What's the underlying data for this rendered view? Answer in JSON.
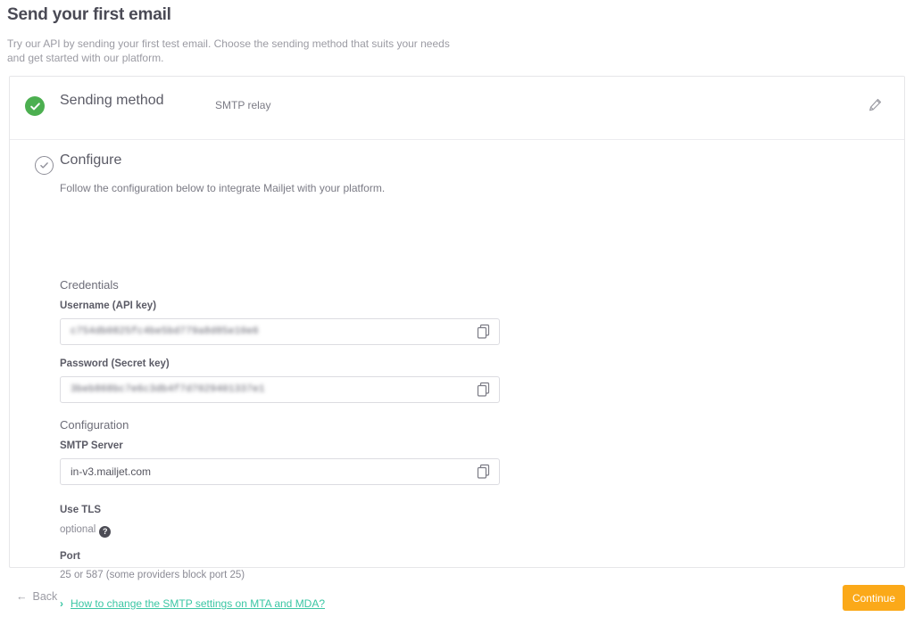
{
  "header": {
    "title": "Send your first email",
    "subtitle": "Try our API by sending your first test email. Choose the sending method that suits your needs and get started with our platform."
  },
  "steps": {
    "sending_method": {
      "label": "Sending method",
      "value": "SMTP relay",
      "edit_icon": "pencil-icon",
      "status_icon": "check-circle-filled-icon"
    },
    "configure": {
      "label": "Configure",
      "description": "Follow the configuration below to integrate Mailjet with your platform.",
      "status_icon": "check-circle-outline-icon"
    }
  },
  "credentials": {
    "section_title": "Credentials",
    "username": {
      "label": "Username (API key)",
      "value": "c754db0825fc4be5bd779a8d85e10e6",
      "redacted": true,
      "copy_icon": "copy-icon"
    },
    "password": {
      "label": "Password (Secret key)",
      "value": "3beb868bc7e6c3db4f7d7029401337e1",
      "redacted": true,
      "copy_icon": "copy-icon"
    }
  },
  "configuration": {
    "section_title": "Configuration",
    "smtp_server": {
      "label": "SMTP Server",
      "value": "in-v3.mailjet.com",
      "copy_icon": "copy-icon"
    },
    "use_tls": {
      "label": "Use TLS",
      "value": "optional",
      "help_icon": "question-mark-icon"
    },
    "port": {
      "label": "Port",
      "value": "25 or 587 (some providers block port 25)"
    }
  },
  "doc_link": {
    "label": "How to change the SMTP settings on MTA and MDA?",
    "chevron_icon": "chevron-right-icon"
  },
  "footer": {
    "back_label": "Back",
    "back_icon": "arrow-left-icon",
    "continue_label": "Continue"
  },
  "colors": {
    "accent_link": "#3bc6a4",
    "success": "#4caf50",
    "primary_button": "#fba919"
  }
}
